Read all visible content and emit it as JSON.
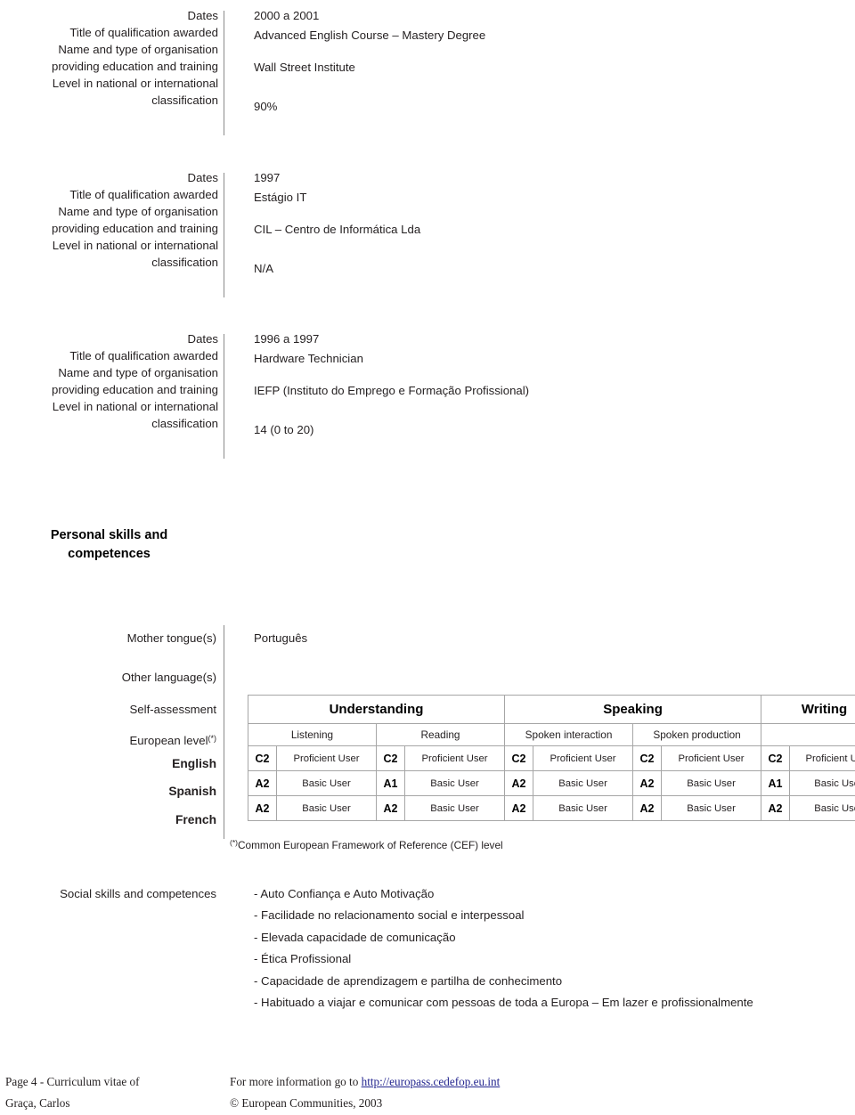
{
  "document": {
    "field_labels": {
      "dates": "Dates",
      "title_of_qualification": "Title of qualification awarded",
      "organisation_line1": "Name and type of organisation",
      "organisation_line2": "providing education and training",
      "level_line1": "Level in national or international",
      "level_line2": "classification"
    },
    "education_entries": [
      {
        "dates": "2000 a 2001",
        "qualification": "Advanced English Course – Mastery Degree",
        "organisation": "Wall Street Institute",
        "level": "90%"
      },
      {
        "dates": "1997",
        "qualification": "Estágio IT",
        "organisation": "CIL – Centro de Informática Lda",
        "level": "N/A"
      },
      {
        "dates": "1996 a 1997",
        "qualification": "Hardware Technician",
        "organisation": "IEFP (Instituto do Emprego e Formação Profissional)",
        "level": "14 (0 to 20)"
      }
    ],
    "personal_skills": {
      "heading_line1": "Personal skills and",
      "heading_line2": "competences",
      "mother_tongue_label": "Mother tongue(s)",
      "mother_tongue_value": "Português",
      "other_languages_label": "Other language(s)",
      "self_assessment_label": "Self-assessment",
      "european_level_label": "European level",
      "european_level_sup": "(*)",
      "cef_note_sup": "(*)",
      "cef_note_text": "Common European Framework of Reference (CEF) level"
    },
    "language_table": {
      "groups": [
        {
          "label": "Understanding",
          "colspan": 4
        },
        {
          "label": "Speaking",
          "colspan": 4
        },
        {
          "label": "Writing",
          "colspan": 2
        }
      ],
      "subheaders": [
        "Listening",
        "Reading",
        "Spoken interaction",
        "Spoken production",
        ""
      ],
      "rows": [
        {
          "language": "English",
          "cells": [
            {
              "level": "C2",
              "desc": "Proficient User"
            },
            {
              "level": "C2",
              "desc": "Proficient User"
            },
            {
              "level": "C2",
              "desc": "Proficient User"
            },
            {
              "level": "C2",
              "desc": "Proficient User"
            },
            {
              "level": "C2",
              "desc": "Proficient User"
            }
          ]
        },
        {
          "language": "Spanish",
          "cells": [
            {
              "level": "A2",
              "desc": "Basic User"
            },
            {
              "level": "A1",
              "desc": "Basic User"
            },
            {
              "level": "A2",
              "desc": "Basic User"
            },
            {
              "level": "A2",
              "desc": "Basic User"
            },
            {
              "level": "A1",
              "desc": "Basic User"
            }
          ]
        },
        {
          "language": "French",
          "cells": [
            {
              "level": "A2",
              "desc": "Basic User"
            },
            {
              "level": "A2",
              "desc": "Basic User"
            },
            {
              "level": "A2",
              "desc": "Basic User"
            },
            {
              "level": "A2",
              "desc": "Basic User"
            },
            {
              "level": "A2",
              "desc": "Basic User"
            }
          ]
        }
      ]
    },
    "social_skills": {
      "label": "Social skills and competences",
      "items": [
        "- Auto Confiança e Auto Motivação",
        "- Facilidade no relacionamento social e interpessoal",
        "- Elevada capacidade de comunicação",
        "- Ética Profissional",
        "- Capacidade de aprendizagem e partilha de conhecimento",
        "- Habituado a viajar e comunicar com pessoas de toda a Europa – Em lazer e profissionalmente"
      ]
    },
    "footer": {
      "page_line1": "Page 4 - Curriculum vitae of",
      "page_line2": "Graça, Carlos",
      "info_prefix": "For more information go to ",
      "info_url": "http://europass.cedefop.eu.int",
      "copyright": "© European Communities, 2003",
      "link_color": "#24268f"
    }
  }
}
